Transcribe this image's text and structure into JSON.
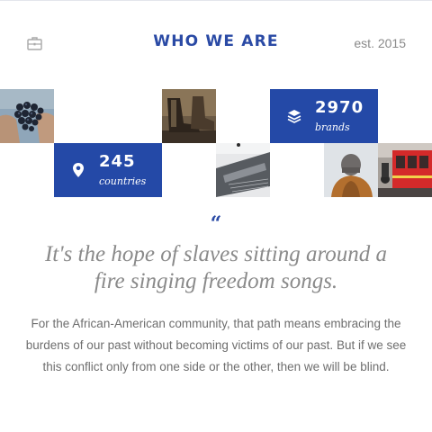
{
  "header": {
    "title": "WHO WE ARE",
    "established": "est. 2015",
    "icon": "briefcase-icon"
  },
  "stats": [
    {
      "value": "245",
      "label": "countries",
      "icon": "map-pin-icon"
    },
    {
      "value": "2970",
      "label": "brands",
      "icon": "layers-icon"
    }
  ],
  "gallery": [
    "grapes-photo",
    "boots-photo",
    "laptop-photo",
    "beanie-photo",
    "red-train-photo"
  ],
  "quote": {
    "mark": "“",
    "text": "It's the hope of slaves sitting around a fire singing freedom songs."
  },
  "body": "For the African-American community, that path means embracing the burdens of our past without becoming victims of our past. But if we see this conflict only from one side or the other, then we will be blind.",
  "colors": {
    "accent": "#2449a7",
    "title": "#2a4aa5",
    "muted": "#8a8a8a"
  }
}
